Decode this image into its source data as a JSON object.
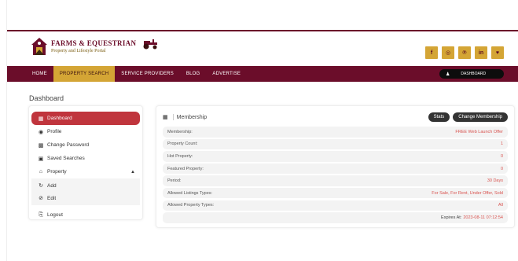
{
  "brand": {
    "name": "FARMS & EQUESTRIAN",
    "tagline": "Property and Lifestyle Portal",
    "color_primary": "#6b0d2a",
    "color_accent": "#d4a535"
  },
  "social": [
    {
      "icon": "facebook-icon",
      "glyph": "f"
    },
    {
      "icon": "instagram-icon",
      "glyph": "◎"
    },
    {
      "icon": "pinterest-icon",
      "glyph": "℗"
    },
    {
      "icon": "linkedin-icon",
      "glyph": "in"
    },
    {
      "icon": "twitter-icon",
      "glyph": "♥"
    }
  ],
  "nav": {
    "items": [
      {
        "label": "HOME"
      },
      {
        "label": "PROPERTY SEARCH"
      },
      {
        "label": "SERVICE PROVIDERS"
      },
      {
        "label": "BLOG"
      },
      {
        "label": "ADVERTISE"
      }
    ],
    "dashboard_label": "DASHBOARD"
  },
  "page": {
    "title": "Dashboard"
  },
  "sidebar": {
    "items": [
      {
        "label": "Dashboard",
        "icon": "grid-icon"
      },
      {
        "label": "Profile",
        "icon": "user-circle-icon"
      },
      {
        "label": "Change Password",
        "icon": "lock-icon"
      },
      {
        "label": "Saved Searches",
        "icon": "saved-icon"
      },
      {
        "label": "Property",
        "icon": "home-icon"
      },
      {
        "label": "Add",
        "icon": "add-icon"
      },
      {
        "label": "Edit",
        "icon": "edit-icon"
      },
      {
        "label": "Logout",
        "icon": "logout-icon"
      }
    ]
  },
  "membership": {
    "title": "Membership",
    "stats_button": "Stats",
    "change_button": "Change Membership",
    "rows": [
      {
        "label": "Membership:",
        "value": "FREE Web Launch Offer"
      },
      {
        "label": "Property Count:",
        "value": "1"
      },
      {
        "label": "Hot Property:",
        "value": "0"
      },
      {
        "label": "Featured Property:",
        "value": "0"
      },
      {
        "label": "Period:",
        "value": "30 Days"
      },
      {
        "label": "Allowed Listings Types:",
        "value": "For Sale, For Rent, Under Offer, Sold"
      },
      {
        "label": "Allowed Property Types:",
        "value": "All"
      }
    ],
    "expires_label": "Expires At:",
    "expires_value": "2023-08-11 07:12:54"
  }
}
